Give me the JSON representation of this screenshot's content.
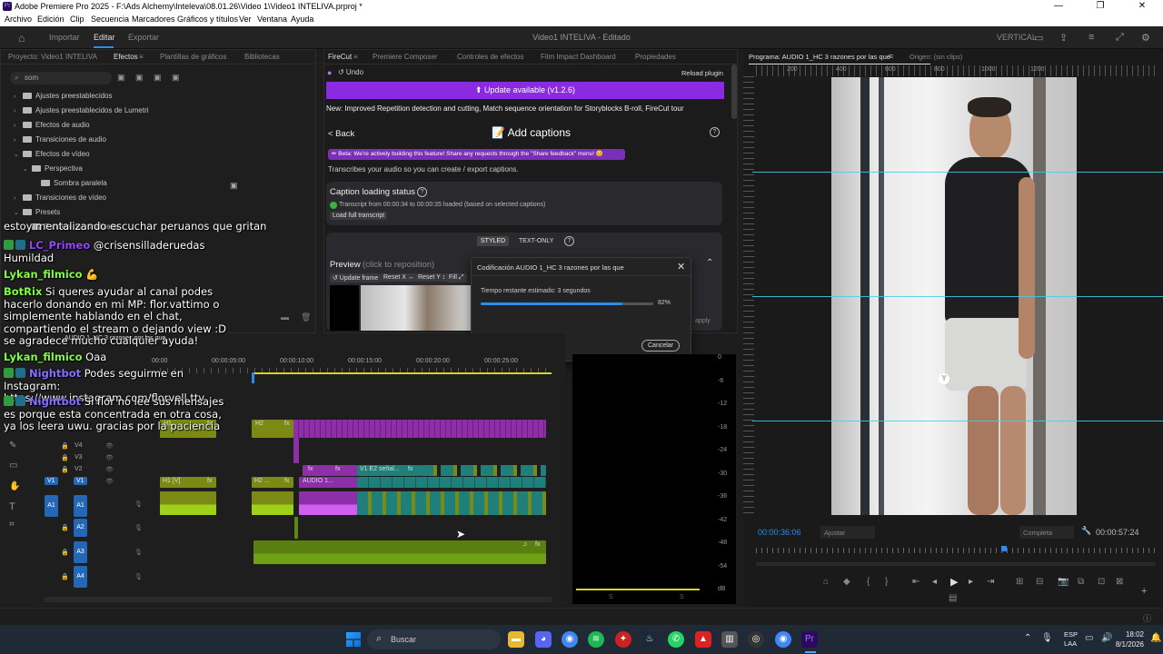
{
  "window": {
    "title": "Adobe Premiere Pro 2025 - F:\\Ads Alchemy\\Inteleva\\08.01.26\\Video 1\\Video1 INTELIVA.prproj *",
    "controls": [
      "—",
      "❐",
      "✕"
    ]
  },
  "menu": [
    "Archivo",
    "Edición",
    "Clip",
    "Secuencia",
    "Marcadores",
    "Gráficos y títulos",
    "Ver",
    "Ventana",
    "Ayuda"
  ],
  "workspace": {
    "tabs": [
      "Importar",
      "Editar",
      "Exportar"
    ],
    "active": "Editar",
    "project_title": "Video1 INTELIVA - Editado",
    "right_label": "VERTICAL"
  },
  "left_panel": {
    "tabs": [
      "Proyecto: Video1 INTELIVA",
      "Efectos",
      "Plantillas de gráficos",
      "Bibliotecas"
    ],
    "search_value": "som",
    "tree": [
      {
        "label": "Ajustes preestablecidos",
        "caret": "›",
        "indent": 0
      },
      {
        "label": "Ajustes preestablecidos de Lumetri",
        "caret": "›",
        "indent": 0
      },
      {
        "label": "Efectos de audio",
        "caret": "›",
        "indent": 0
      },
      {
        "label": "Transiciones de audio",
        "caret": "›",
        "indent": 0
      },
      {
        "label": "Efectos de vídeo",
        "caret": "⌄",
        "indent": 0
      },
      {
        "label": "Perspectiva",
        "caret": "⌄",
        "indent": 1
      },
      {
        "label": "Sombra paralela",
        "caret": "",
        "indent": 2
      },
      {
        "label": "Transiciones de vídeo",
        "caret": "›",
        "indent": 0
      },
      {
        "label": "Presets",
        "caret": "⌄",
        "indent": 0
      },
      {
        "label": "Bandeja personalizada",
        "caret": "",
        "indent": 1
      }
    ]
  },
  "chat": [
    {
      "user": "",
      "text": "estoy mentalizando escuchar peruanos que gritan",
      "color": "#ffffff",
      "badges": false
    },
    {
      "user": "LC_Primeo",
      "text": "@crisensilladeruedas",
      "color": "#9146ff",
      "badges": true
    },
    {
      "user": "",
      "text": "Humildad",
      "color": "#ffffff",
      "badges": false
    },
    {
      "user": "Lykan_filmico",
      "text": "💪",
      "color": "#7fff3a",
      "badges": false
    },
    {
      "user": "BotRix",
      "text": "Si queres ayudar al canal podes hacerlo donando en mi MP: flor.vattimo o simplemente hablando en el chat, compartiendo el stream o dejando view :D se agradece mucho cualquier ayuda!",
      "color": "#7fff3a",
      "badges": false
    },
    {
      "user": "Lykan_filmico",
      "text": "Oaa",
      "color": "#7fff3a",
      "badges": false
    },
    {
      "user": "Nightbot",
      "text": "Podes seguirme en Instagram: https://www.instagram.com/florvell.ttv",
      "color": "#8a6cff",
      "badges": true
    },
    {
      "user": "Nightbot",
      "text": "Si flor no lee sus mensajes es porque esta concentrada en otra cosa, ya los leera uwu. gracias por la paciencia",
      "color": "#8a6cff",
      "badges": true
    }
  ],
  "firecut_panel": {
    "tabs": [
      "FireCut",
      "Premiere Composer",
      "Controles de efectos",
      "Film Impact Dashboard",
      "Propiedades"
    ],
    "undo": "↺ Undo",
    "reload": "Reload plugin",
    "update": "⬆ Update available (v1.2.6)",
    "news": "New: Improved Repetition detection and cutting, Match sequence orientation for Storyblocks B-roll, FireCut tour",
    "back": "< Back",
    "heading": "📝 Add captions",
    "beta": "✏ Beta:  We're actively building this feature! Share any requests through the \"Share feedback\" menu! 😊",
    "desc": "Transcribes your audio so you can create / export captions.",
    "status_title": "Caption loading status",
    "status_line": "Transcript from 00:00:34 to 00:00:35 loaded (based on selected captions)",
    "load_button": "Load full transcript",
    "mode_styled": "STYLED",
    "mode_text": "TEXT-ONLY",
    "preview": "Preview",
    "preview_hint": "(click to reposition)",
    "preview_buttons": [
      "↺ Update frame",
      "Reset X ↔",
      "Reset Y ↕",
      "Fill ⤢"
    ],
    "apply": "apply"
  },
  "dialog": {
    "title": "Codificación AUDIO 1_HC 3 razones por las que",
    "remaining": "Tiempo restante estimado: 3 segundos",
    "percent_label": "82%",
    "progress": 0.82,
    "cancel": "Cancelar"
  },
  "timeline": {
    "sequence": "AUDIO 1_HC 3 razones por las que",
    "ruler": [
      "00:00",
      "00:00:05:00",
      "00:00:10:00",
      "00:00:15:00",
      "00:00:20:00",
      "00:00:25:00"
    ],
    "tracks": [
      "V4",
      "V3",
      "V2",
      "V1",
      "A1",
      "A2",
      "A3",
      "A4"
    ],
    "clip_labels": {
      "h1": "H1",
      "h2": "H2",
      "h1v": "H1 [V]",
      "h2v": "H2 ...",
      "audio1": "AUDIO 1...",
      "v1e2": "V1 E2 señal...",
      "fx": "fx"
    }
  },
  "meter_scale": [
    "0",
    "-6",
    "-12",
    "-18",
    "-24",
    "-30",
    "-36",
    "-42",
    "-48",
    "-54",
    "dB"
  ],
  "meter_bottom": [
    "S",
    "S"
  ],
  "program": {
    "tab": "Programa: AUDIO 1_HC 3 razones por las que",
    "source_tab": "Origen: (sin clips)",
    "ruler": [
      "200",
      "400",
      "600",
      "800",
      "1000",
      "1200"
    ],
    "timecode_left": "00:00:36:06",
    "fit": "Ajustar",
    "quality": "Completa",
    "timecode_right": "00:00:57:24"
  },
  "taskbar": {
    "search_placeholder": "Buscar",
    "lang": "ESP",
    "lang2": "LAA",
    "time": "18:02",
    "date": "8/1/2026"
  },
  "colors": {
    "accent": "#8a2be2",
    "guide": "#3fd0e8",
    "clip_green": "#7a8a12",
    "clip_purple": "#8e2ea8",
    "clip_teal": "#1f7f7a"
  }
}
